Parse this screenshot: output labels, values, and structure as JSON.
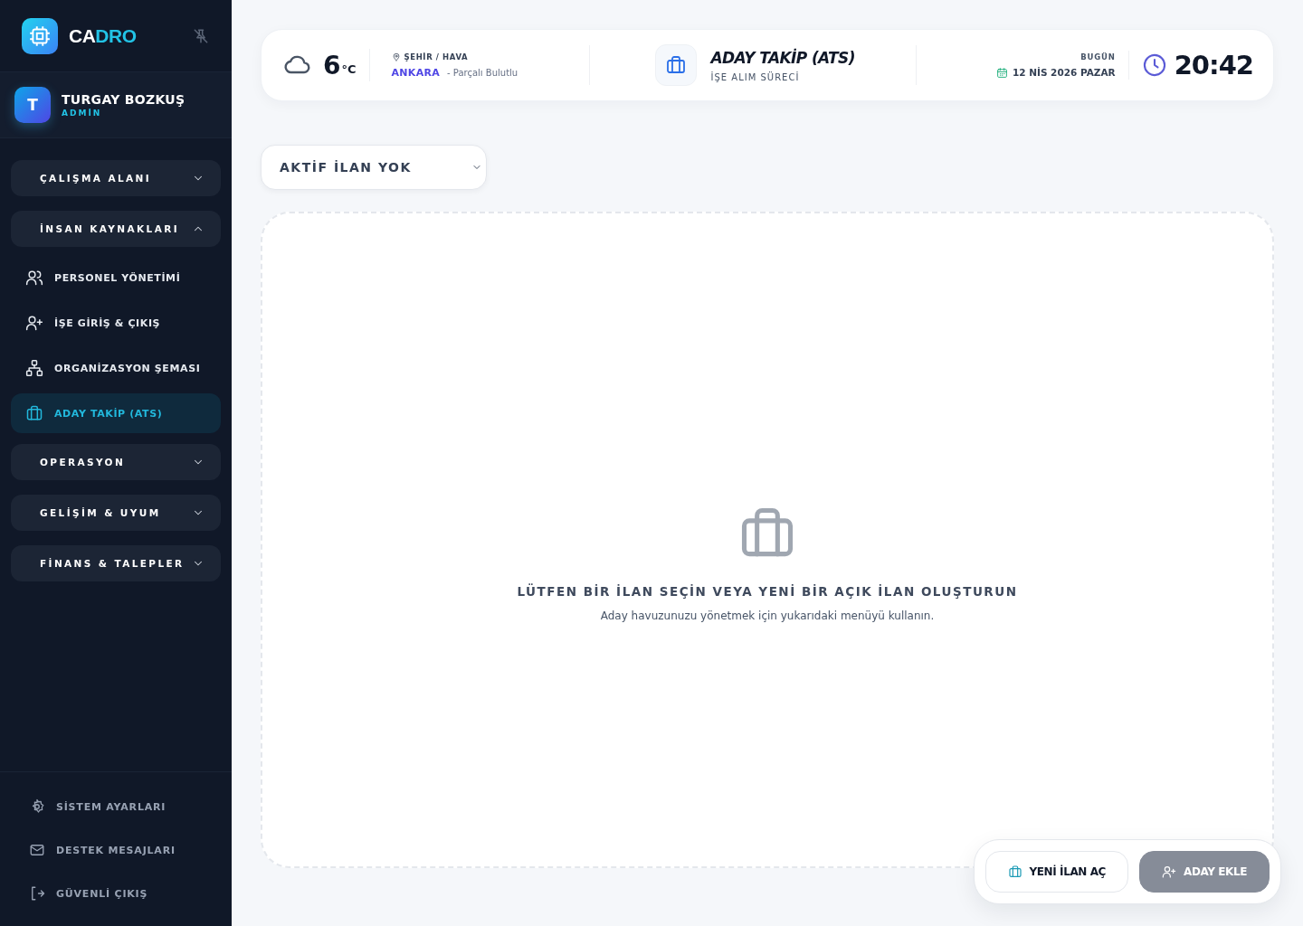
{
  "sidebar": {
    "logo": [
      "CA",
      "DRO"
    ],
    "user": {
      "initial": "T",
      "name": "TURGAY BOZKUŞ",
      "role": "ADMİN"
    },
    "groups": [
      {
        "label": "ÇALIŞMA ALANI",
        "expanded": false
      },
      {
        "label": "İNSAN KAYNAKLARI",
        "expanded": true,
        "items": [
          {
            "label": "PERSONEL YÖNETİMİ",
            "selected": false
          },
          {
            "label": "İŞE GİRİŞ & ÇIKIŞ",
            "selected": false
          },
          {
            "label": "ORGANİZASYON ŞEMASI",
            "selected": false
          },
          {
            "label": "ADAY TAKİP (ATS)",
            "selected": true
          }
        ]
      },
      {
        "label": "OPERASYON",
        "expanded": false
      },
      {
        "label": "GELİŞİM & UYUM",
        "expanded": false
      },
      {
        "label": "FİNANS & TALEPLER",
        "expanded": false
      }
    ],
    "footer": [
      "SİSTEM AYARLARI",
      "DESTEK MESAJLARI",
      "GÜVENLİ ÇIKIŞ"
    ]
  },
  "header": {
    "temperature": "6",
    "unit": "°C",
    "location_label": "ŞEHİR / HAVA",
    "city": "ANKARA",
    "weather": "- Parçalı Bulutlu",
    "title": "ADAY TAKİP (ATS)",
    "subtitle": "İŞE ALIM SÜRECİ",
    "date_label": "BUGÜN",
    "date": "12 NİS 2026 PAZAR",
    "time": "20:42"
  },
  "job_select": {
    "value": "AKTİF İLAN YOK"
  },
  "empty_state": {
    "title": "LÜTFEN BİR İLAN SEÇİN VEYA YENİ BİR AÇIK İLAN OLUŞTURUN",
    "text": "Aday havuzunuzu yönetmek için yukarıdaki menüyü kullanın."
  },
  "actions": [
    {
      "label": "YENİ İLAN AÇ",
      "disabled": false
    },
    {
      "label": "ADAY EKLE",
      "disabled": true
    }
  ]
}
